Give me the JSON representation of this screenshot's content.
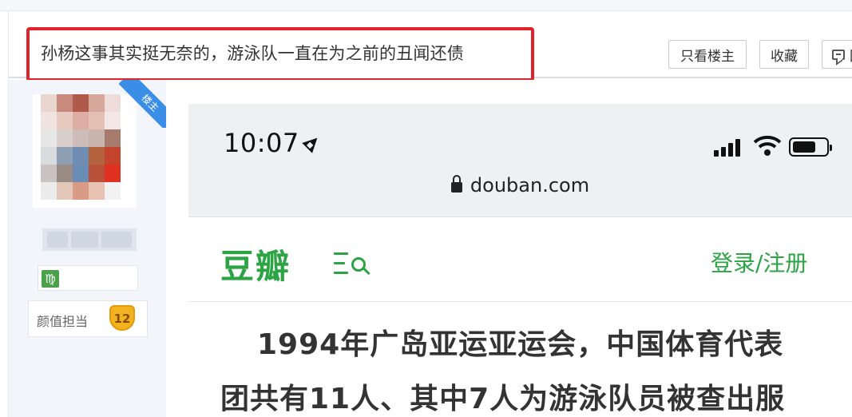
{
  "post": {
    "title": "孙杨这事其实挺无奈的，游泳队一直在为之前的丑闻还债",
    "buttons": {
      "only_op": "只看楼主",
      "favorite": "收藏",
      "reply": "回"
    }
  },
  "author": {
    "op_badge": "楼主",
    "badge_name": "颜值担当",
    "badge_level": "12",
    "zodiac_symbol": "♍"
  },
  "screenshot": {
    "time": "10:07",
    "url": "douban.com",
    "logo": "豆瓣",
    "login": "登录/注册",
    "article_lines": [
      "1994年广岛亚运亚运会，中国体育代表",
      "团共有11人、其中7人为游泳队员被查出服"
    ]
  },
  "colors": {
    "highlight_border": "#e0242b",
    "douban_green": "#2ca444",
    "op_ribbon": "#3a8ee6",
    "badge_gold": "#f2b320"
  }
}
